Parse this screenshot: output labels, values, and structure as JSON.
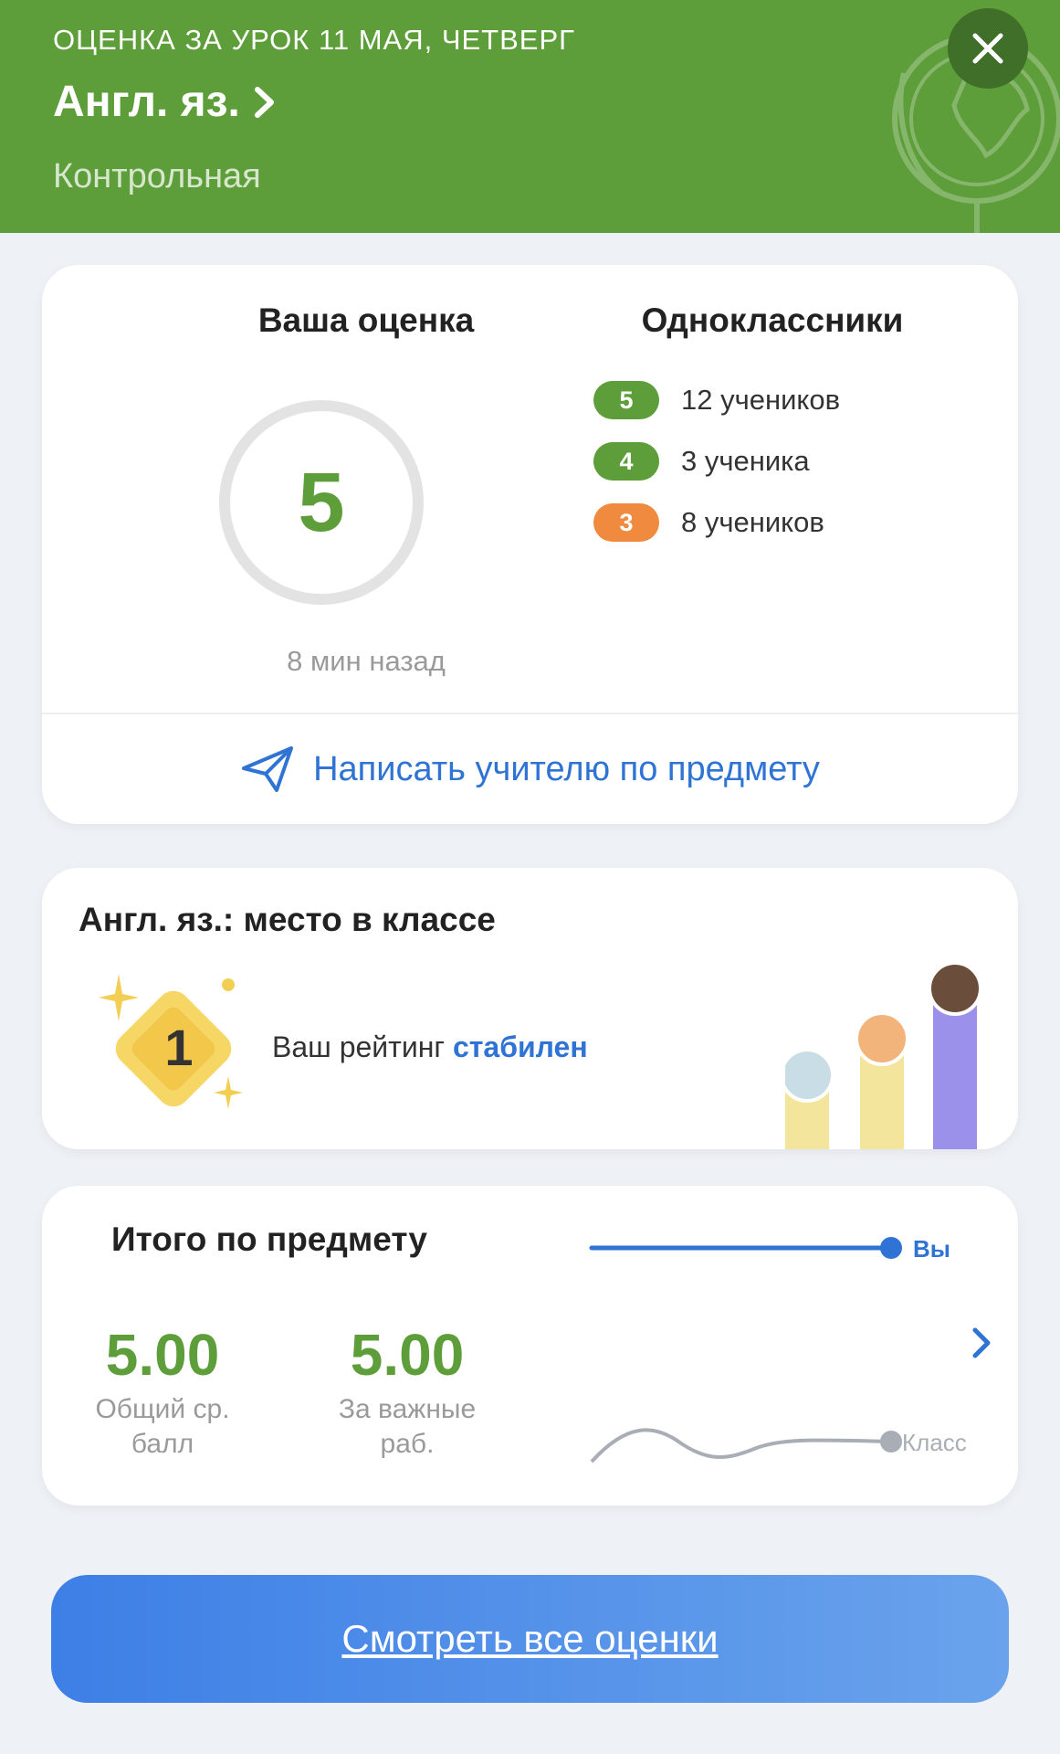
{
  "header": {
    "date_line": "ОЦЕНКА ЗА УРОК 11 МАЯ, ЧЕТВЕРГ",
    "subject": "Англ. яз.",
    "lesson_type": "Контрольная",
    "close_icon": "close-icon",
    "color": "#5e9e3a"
  },
  "grade_card": {
    "your_grade_title": "Ваша оценка",
    "grade": "5",
    "time_ago": "8 мин назад",
    "classmates_title": "Одноклассники",
    "distribution": [
      {
        "grade": "5",
        "count": "12 учеников",
        "color": "#5e9e3a"
      },
      {
        "grade": "4",
        "count": "3 ученика",
        "color": "#5e9e3a"
      },
      {
        "grade": "3",
        "count": "8 учеников",
        "color": "#ef8a3f"
      }
    ],
    "write_teacher": "Написать учителю по предмету"
  },
  "rank_card": {
    "title": "Англ. яз.: место в классе",
    "place": "1",
    "rating_prefix": "Ваш рейтинг",
    "rating_status": "стабилен"
  },
  "total_card": {
    "title": "Итого по предмету",
    "avg_value": "5.00",
    "avg_label_1": "Общий ср.",
    "avg_label_2": "балл",
    "important_value": "5.00",
    "important_label_1": "За важные",
    "important_label_2": "раб.",
    "you_label": "Вы",
    "class_label": "Класс"
  },
  "footer": {
    "all_grades_button": "Смотреть все оценки"
  }
}
